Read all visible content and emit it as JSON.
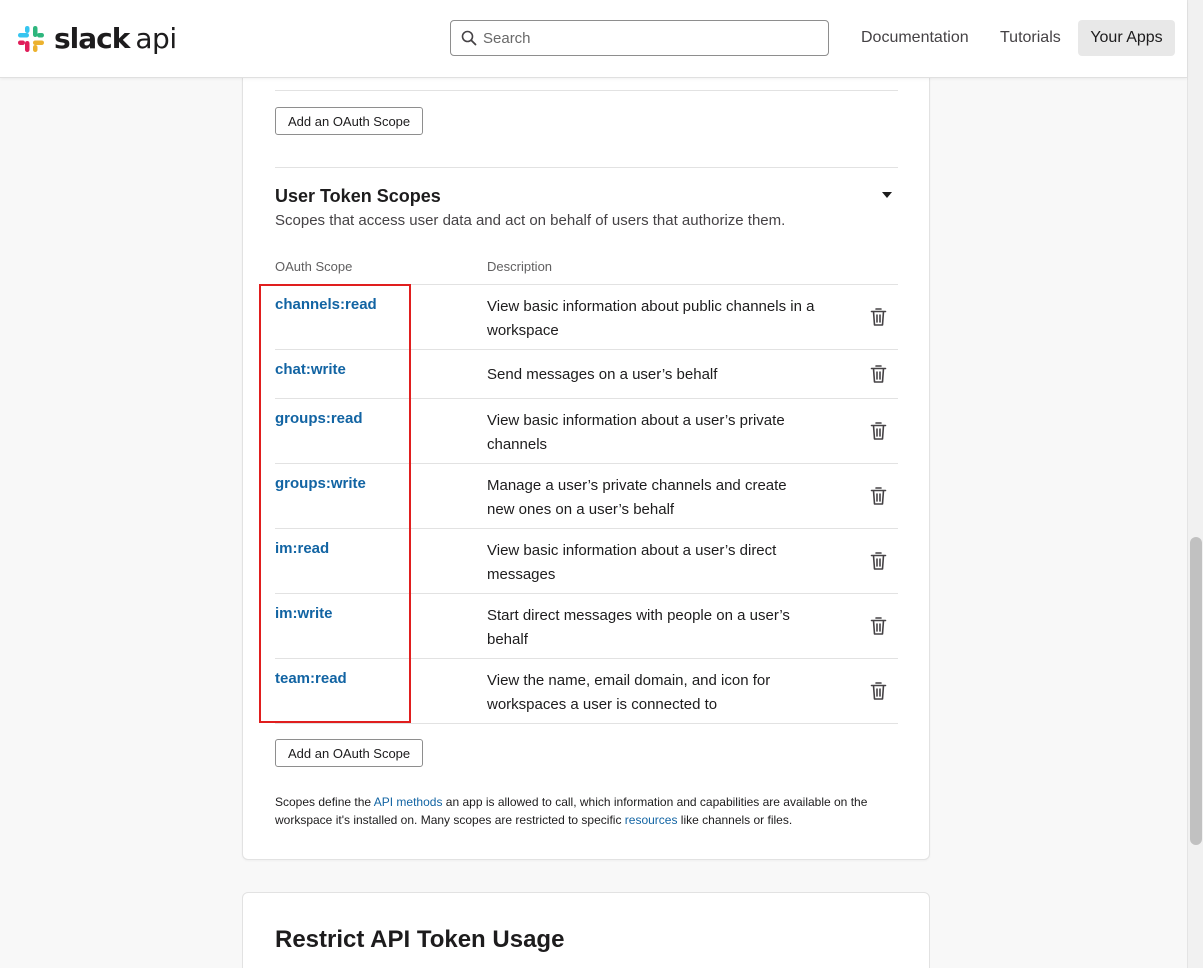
{
  "brand": {
    "name": "slack",
    "suffix": "api"
  },
  "search": {
    "placeholder": "Search",
    "value": ""
  },
  "nav": {
    "documentation": "Documentation",
    "tutorials": "Tutorials",
    "your_apps": "Your Apps"
  },
  "bot_section": {
    "add_scope_label": "Add an OAuth Scope"
  },
  "user_section": {
    "title": "User Token Scopes",
    "description": "Scopes that access user data and act on behalf of users that authorize them.",
    "col_scope": "OAuth Scope",
    "col_description": "Description",
    "scopes": [
      {
        "name": "channels:read",
        "description": "View basic information about public channels in a workspace"
      },
      {
        "name": "chat:write",
        "description": "Send messages on a user’s behalf"
      },
      {
        "name": "groups:read",
        "description": "View basic information about a user’s private channels"
      },
      {
        "name": "groups:write",
        "description": "Manage a user’s private channels and create new ones on a user’s behalf"
      },
      {
        "name": "im:read",
        "description": "View basic information about a user’s direct messages"
      },
      {
        "name": "im:write",
        "description": "Start direct messages with people on a user’s behalf"
      },
      {
        "name": "team:read",
        "description": "View the name, email domain, and icon for workspaces a user is connected to"
      }
    ],
    "add_scope_label": "Add an OAuth Scope"
  },
  "footnote": {
    "part1": "Scopes define the ",
    "link1": "API methods",
    "part2": " an app is allowed to call, which information and capabilities are available on the workspace it's installed on. Many scopes are restricted to specific ",
    "link2": "resources",
    "part3": " like channels or files."
  },
  "restrict_section": {
    "title": "Restrict API Token Usage"
  },
  "colors": {
    "link": "#1264a3",
    "highlight": "#e01e1e",
    "logo_blue": "#36c5f0",
    "logo_green": "#2eb67d",
    "logo_yellow": "#ecb22e",
    "logo_red": "#e01e5a"
  }
}
